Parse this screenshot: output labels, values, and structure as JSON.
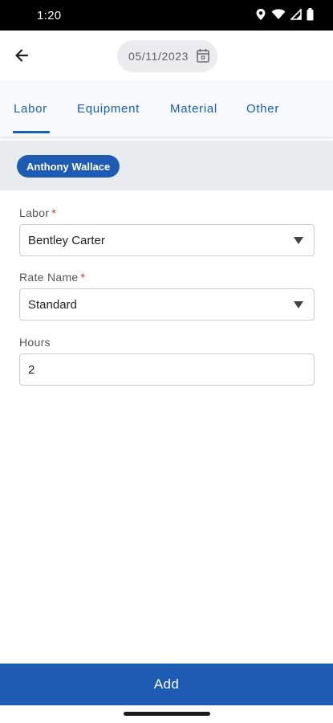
{
  "status_bar": {
    "time": "1:20",
    "icons": [
      "location-icon",
      "wifi-icon",
      "signal-icon",
      "battery-icon"
    ]
  },
  "header": {
    "back_icon": "arrow-left-icon",
    "date": "05/11/2023",
    "calendar_icon": "calendar-icon"
  },
  "tabs": [
    {
      "label": "Labor",
      "active": true
    },
    {
      "label": "Equipment",
      "active": false
    },
    {
      "label": "Material",
      "active": false
    },
    {
      "label": "Other",
      "active": false
    }
  ],
  "selected_person": "Anthony Wallace",
  "form": {
    "labor": {
      "label": "Labor",
      "required_mark": "*",
      "value": "Bentley Carter"
    },
    "rate_name": {
      "label": "Rate Name",
      "required_mark": "*",
      "value": "Standard"
    },
    "hours": {
      "label": "Hours",
      "value": "2"
    }
  },
  "actions": {
    "add_label": "Add"
  },
  "colors": {
    "accent": "#1e5bb3",
    "tab_text": "#1a5fb4",
    "required": "#d32f2f"
  }
}
